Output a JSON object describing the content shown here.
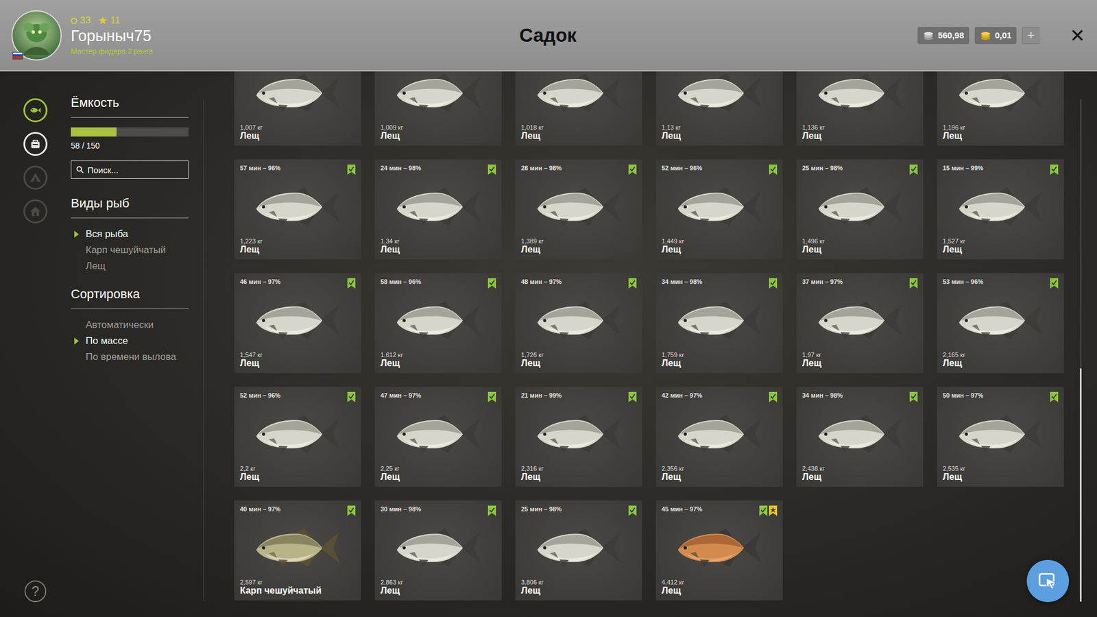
{
  "header": {
    "title": "Садок",
    "player": {
      "name": "Горыныч75",
      "rank": "Мастер фидера 2 ранга",
      "level": "33",
      "stars": "11"
    },
    "currency": [
      {
        "value": "560,98",
        "kind": "silver"
      },
      {
        "value": "0,01",
        "kind": "gold"
      }
    ],
    "add_button": "+",
    "close_button": "×"
  },
  "nav": [
    {
      "kind": "fish",
      "selected": true,
      "disabled": false
    },
    {
      "kind": "bag",
      "selected": false,
      "disabled": false
    },
    {
      "kind": "tent",
      "selected": false,
      "disabled": true
    },
    {
      "kind": "home",
      "selected": false,
      "disabled": true
    }
  ],
  "help": "?",
  "capacity": {
    "title": "Ёмкость",
    "reading": "58 / 150",
    "level": 0.387
  },
  "search": {
    "placeholder": "Поиск..."
  },
  "species": {
    "title": "Виды рыб",
    "items": [
      {
        "label": "Вся рыба",
        "selected": true
      },
      {
        "label": "Карп чешуйчатый",
        "selected": false
      },
      {
        "label": "Лещ",
        "selected": false
      }
    ]
  },
  "sorting": {
    "title": "Сортировка",
    "items": [
      {
        "label": "Автоматически",
        "selected": false
      },
      {
        "label": "По массе",
        "selected": true
      },
      {
        "label": "По времени вылова",
        "selected": false
      }
    ]
  },
  "fish": [
    {
      "time": null,
      "weight": "1,007 кг",
      "name": "Лещ",
      "kind": "bream",
      "marked": false,
      "starred": false
    },
    {
      "time": null,
      "weight": "1,009 кг",
      "name": "Лещ",
      "kind": "bream",
      "marked": false,
      "starred": false
    },
    {
      "time": null,
      "weight": "1,018 кг",
      "name": "Лещ",
      "kind": "bream",
      "marked": false,
      "starred": false
    },
    {
      "time": null,
      "weight": "1,13 кг",
      "name": "Лещ",
      "kind": "bream",
      "marked": false,
      "starred": false
    },
    {
      "time": null,
      "weight": "1,136 кг",
      "name": "Лещ",
      "kind": "bream",
      "marked": false,
      "starred": false
    },
    {
      "time": null,
      "weight": "1,196 кг",
      "name": "Лещ",
      "kind": "bream",
      "marked": false,
      "starred": false
    },
    {
      "time": "57 мин – 96%",
      "weight": "1,223 кг",
      "name": "Лещ",
      "kind": "bream",
      "marked": true,
      "starred": false
    },
    {
      "time": "24 мин – 98%",
      "weight": "1,34 кг",
      "name": "Лещ",
      "kind": "bream",
      "marked": true,
      "starred": false
    },
    {
      "time": "28 мин – 98%",
      "weight": "1,389 кг",
      "name": "Лещ",
      "kind": "bream",
      "marked": true,
      "starred": false
    },
    {
      "time": "52 мин – 96%",
      "weight": "1,449 кг",
      "name": "Лещ",
      "kind": "bream",
      "marked": true,
      "starred": false
    },
    {
      "time": "25 мин – 98%",
      "weight": "1,496 кг",
      "name": "Лещ",
      "kind": "bream",
      "marked": true,
      "starred": false
    },
    {
      "time": "15 мин – 99%",
      "weight": "1,527 кг",
      "name": "Лещ",
      "kind": "bream",
      "marked": true,
      "starred": false
    },
    {
      "time": "46 мин – 97%",
      "weight": "1,547 кг",
      "name": "Лещ",
      "kind": "bream",
      "marked": true,
      "starred": false
    },
    {
      "time": "58 мин – 96%",
      "weight": "1,612 кг",
      "name": "Лещ",
      "kind": "bream",
      "marked": true,
      "starred": false
    },
    {
      "time": "48 мин – 97%",
      "weight": "1,726 кг",
      "name": "Лещ",
      "kind": "bream",
      "marked": true,
      "starred": false
    },
    {
      "time": "34 мин – 98%",
      "weight": "1,759 кг",
      "name": "Лещ",
      "kind": "bream",
      "marked": true,
      "starred": false
    },
    {
      "time": "37 мин – 97%",
      "weight": "1,97 кг",
      "name": "Лещ",
      "kind": "bream",
      "marked": true,
      "starred": false
    },
    {
      "time": "53 мин – 96%",
      "weight": "2,165 кг",
      "name": "Лещ",
      "kind": "bream",
      "marked": true,
      "starred": false
    },
    {
      "time": "52 мин – 96%",
      "weight": "2,2 кг",
      "name": "Лещ",
      "kind": "bream",
      "marked": true,
      "starred": false
    },
    {
      "time": "47 мин – 97%",
      "weight": "2,25 кг",
      "name": "Лещ",
      "kind": "bream",
      "marked": true,
      "starred": false
    },
    {
      "time": "21 мин – 99%",
      "weight": "2,316 кг",
      "name": "Лещ",
      "kind": "bream",
      "marked": true,
      "starred": false
    },
    {
      "time": "42 мин – 97%",
      "weight": "2,356 кг",
      "name": "Лещ",
      "kind": "bream",
      "marked": true,
      "starred": false
    },
    {
      "time": "34 мин – 98%",
      "weight": "2,438 кг",
      "name": "Лещ",
      "kind": "bream",
      "marked": true,
      "starred": false
    },
    {
      "time": "50 мин – 97%",
      "weight": "2,535 кг",
      "name": "Лещ",
      "kind": "bream",
      "marked": true,
      "starred": false
    },
    {
      "time": "40 мин – 97%",
      "weight": "2,597 кг",
      "name": "Карп чешуйчатый",
      "kind": "carp",
      "marked": true,
      "starred": false
    },
    {
      "time": "30 мин – 98%",
      "weight": "2,863 кг",
      "name": "Лещ",
      "kind": "bream",
      "marked": true,
      "starred": false
    },
    {
      "time": "25 мин – 98%",
      "weight": "3,806 кг",
      "name": "Лещ",
      "kind": "bream",
      "marked": true,
      "starred": false
    },
    {
      "time": "45 мин – 97%",
      "weight": "4,412 кг",
      "name": "Лещ",
      "kind": "golden",
      "marked": true,
      "starred": true
    }
  ],
  "scrollbar": {
    "thumb_start": 0.536,
    "thumb_size": 0.464
  }
}
